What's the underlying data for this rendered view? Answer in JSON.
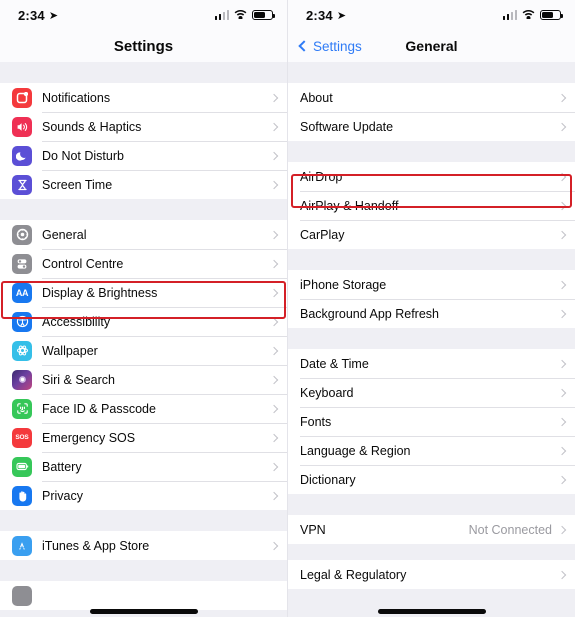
{
  "status_bar": {
    "time": "2:34",
    "location_icon": "location-arrow-icon",
    "signal_icon": "cellular-signal-icon",
    "wifi_icon": "wifi-icon",
    "battery_icon": "battery-icon"
  },
  "left_screen": {
    "title": "Settings",
    "highlighted_row": "General",
    "groups": [
      {
        "rows": [
          {
            "label": "Notifications",
            "icon": "notifications-icon",
            "color": "#f4393c"
          },
          {
            "label": "Sounds & Haptics",
            "icon": "sounds-icon",
            "color": "#ef3054"
          },
          {
            "label": "Do Not Disturb",
            "icon": "do-not-disturb-icon",
            "color": "#5b4fd6"
          },
          {
            "label": "Screen Time",
            "icon": "screen-time-icon",
            "color": "#5b4fd6"
          }
        ]
      },
      {
        "rows": [
          {
            "label": "General",
            "icon": "gear-icon",
            "color": "#8e8e93"
          },
          {
            "label": "Control Centre",
            "icon": "control-centre-icon",
            "color": "#8e8e93"
          },
          {
            "label": "Display & Brightness",
            "icon": "display-icon",
            "color": "#1878f0"
          },
          {
            "label": "Accessibility",
            "icon": "accessibility-icon",
            "color": "#1878f0"
          },
          {
            "label": "Wallpaper",
            "icon": "wallpaper-icon",
            "color": "#35bfe8"
          },
          {
            "label": "Siri & Search",
            "icon": "siri-icon",
            "color": "#2b1b44"
          },
          {
            "label": "Face ID & Passcode",
            "icon": "face-id-icon",
            "color": "#36c759"
          },
          {
            "label": "Emergency SOS",
            "icon": "emergency-sos-icon",
            "color": "#f4393c"
          },
          {
            "label": "Battery",
            "icon": "battery-app-icon",
            "color": "#36c759"
          },
          {
            "label": "Privacy",
            "icon": "privacy-hand-icon",
            "color": "#1878f0"
          }
        ]
      },
      {
        "rows": [
          {
            "label": "iTunes & App Store",
            "icon": "app-store-icon",
            "color": "#3a9ff0"
          }
        ]
      }
    ]
  },
  "right_screen": {
    "back_label": "Settings",
    "title": "General",
    "highlighted_row": "Software Update",
    "groups": [
      {
        "rows": [
          {
            "label": "About"
          },
          {
            "label": "Software Update"
          }
        ]
      },
      {
        "rows": [
          {
            "label": "AirDrop"
          },
          {
            "label": "AirPlay & Handoff"
          },
          {
            "label": "CarPlay"
          }
        ]
      },
      {
        "rows": [
          {
            "label": "iPhone Storage"
          },
          {
            "label": "Background App Refresh"
          }
        ]
      },
      {
        "rows": [
          {
            "label": "Date & Time"
          },
          {
            "label": "Keyboard"
          },
          {
            "label": "Fonts"
          },
          {
            "label": "Language & Region"
          },
          {
            "label": "Dictionary"
          }
        ]
      },
      {
        "rows": [
          {
            "label": "VPN",
            "value": "Not Connected"
          }
        ]
      },
      {
        "rows": [
          {
            "label": "Legal & Regulatory"
          }
        ]
      }
    ]
  },
  "accent_colors": {
    "highlight_box": "#d42027",
    "link_blue": "#2f7bf6",
    "group_background": "#efeff4",
    "row_background": "#ffffff",
    "chevron_gray": "#c2c2c8",
    "value_gray": "#9a9aa0"
  }
}
